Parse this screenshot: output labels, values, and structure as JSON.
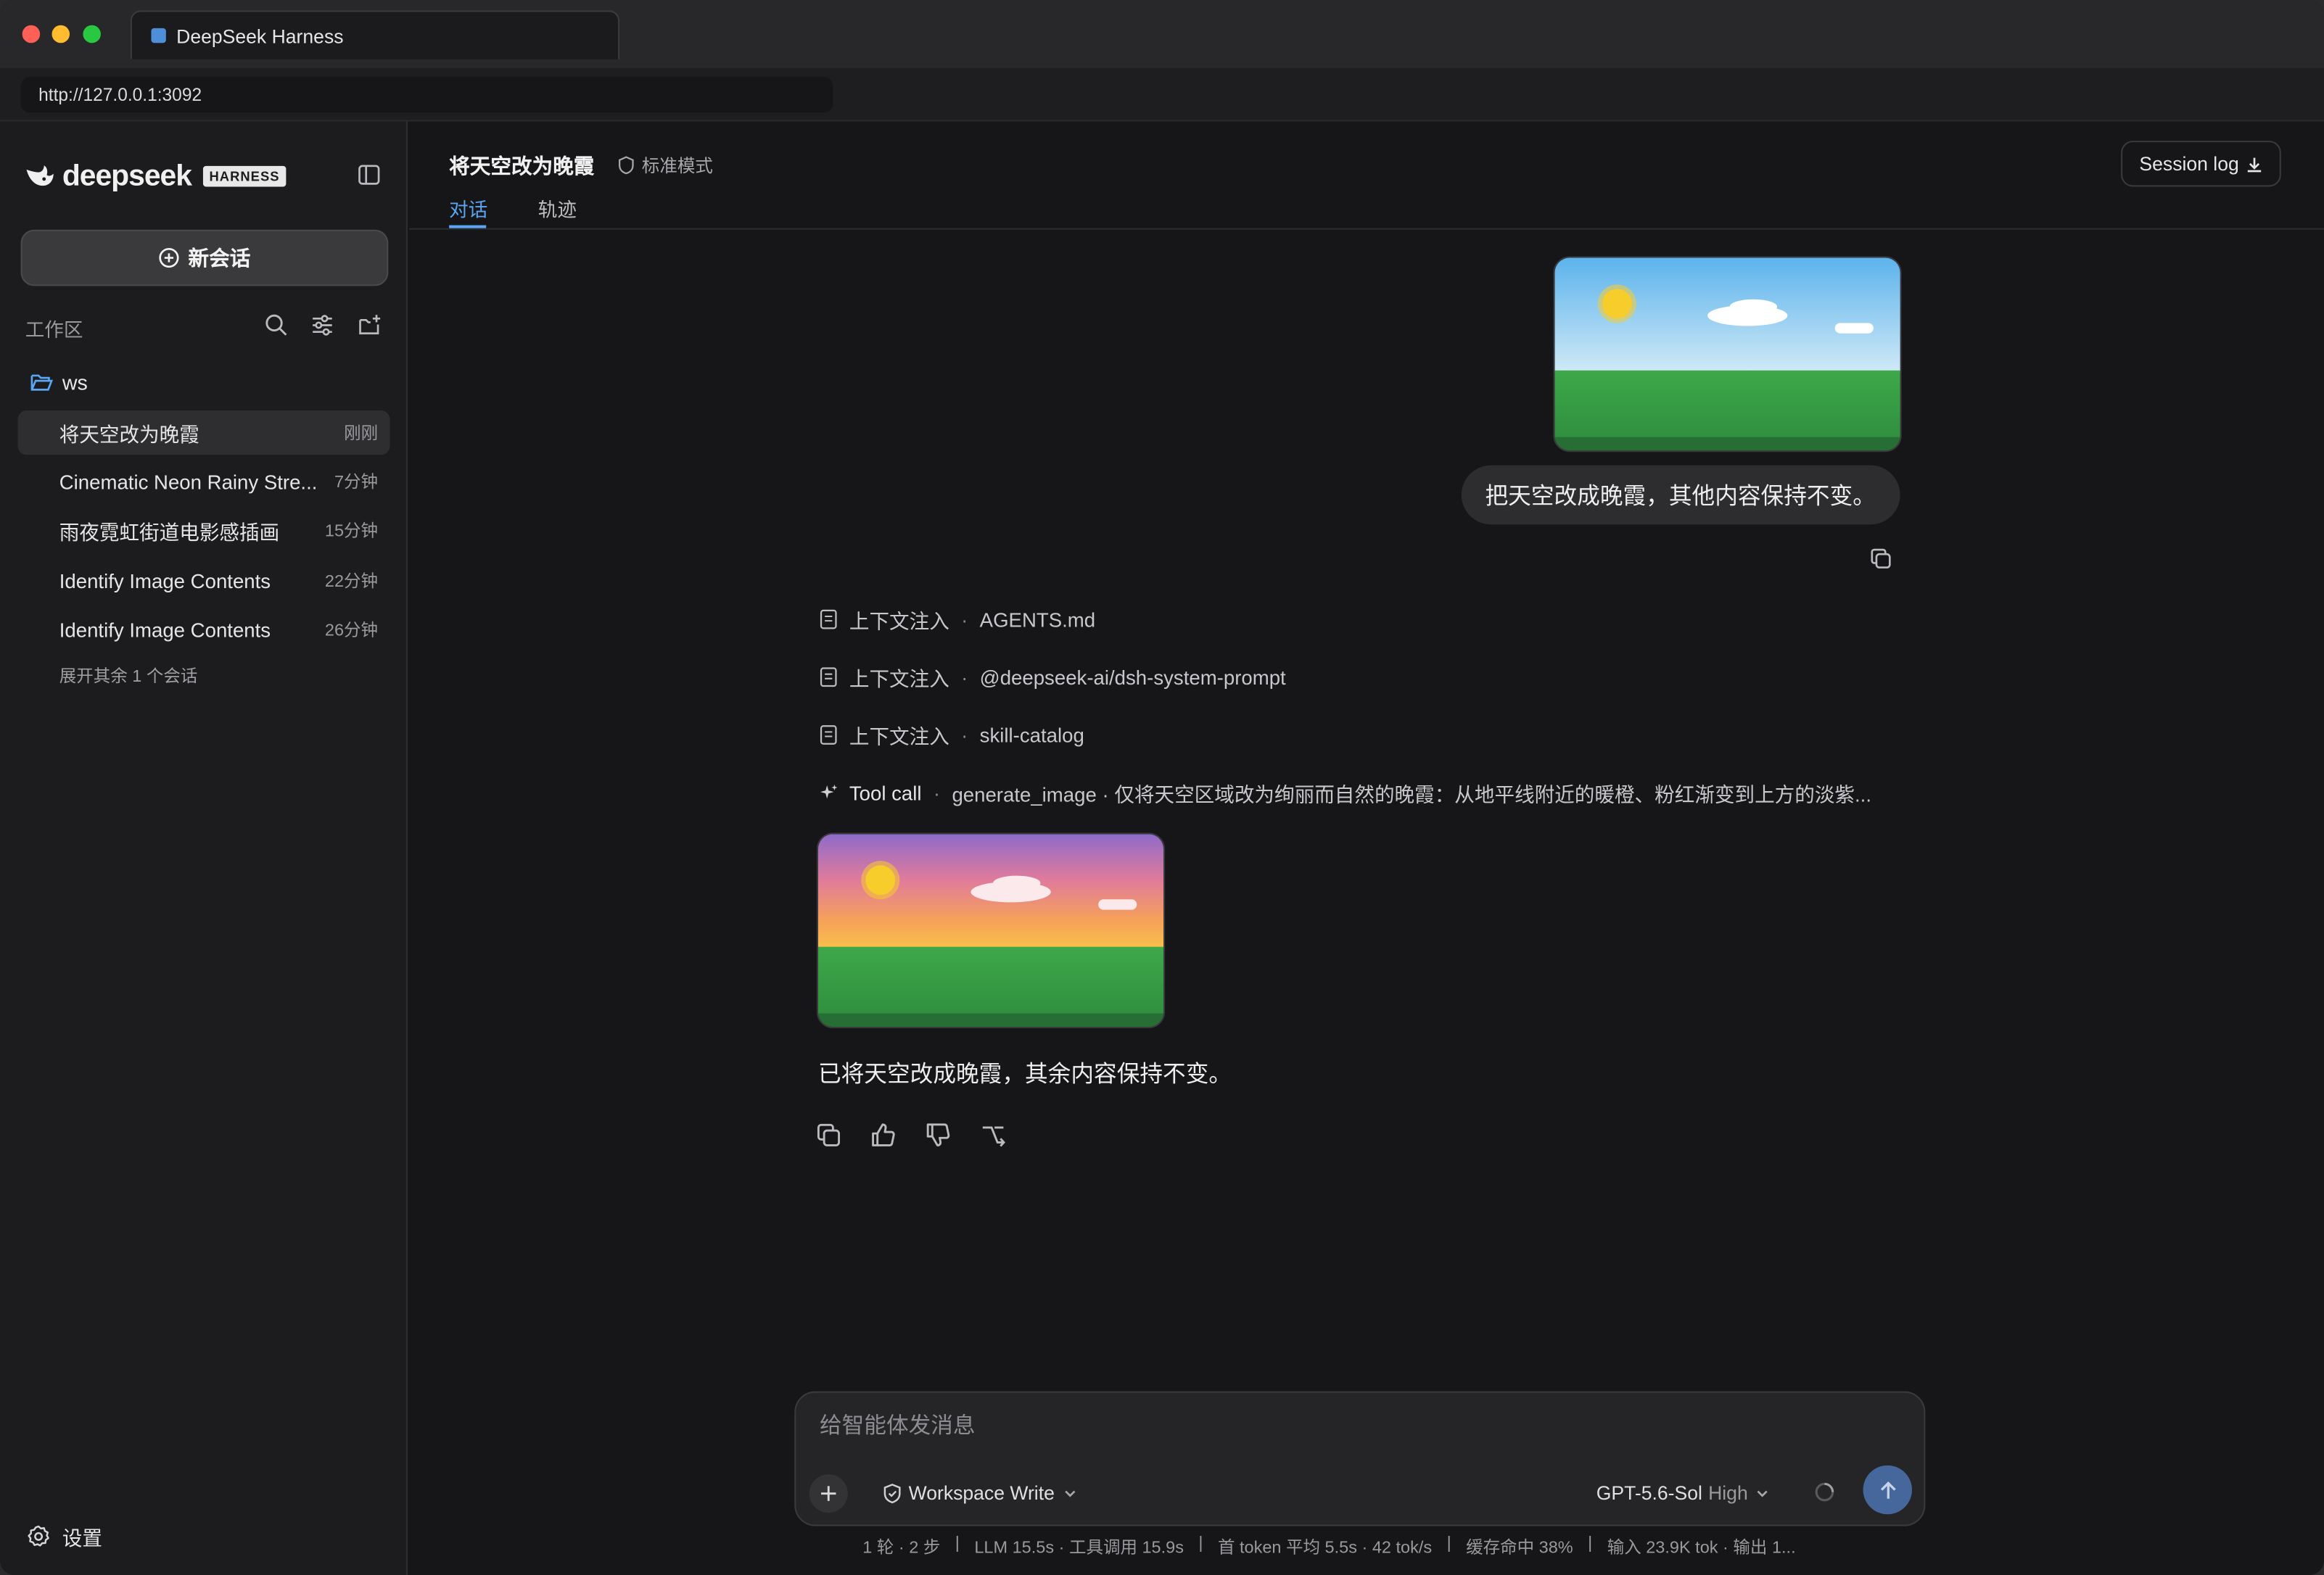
{
  "window": {
    "tab_title": "DeepSeek Harness",
    "url": "http://127.0.0.1:3092"
  },
  "sidebar": {
    "logo_word": "deepseek",
    "logo_badge": "HARNESS",
    "new_chat_label": "新会话",
    "workspace_title": "工作区",
    "folder_name": "ws",
    "sessions": [
      {
        "title": "将天空改为晚霞",
        "time": "刚刚"
      },
      {
        "title": "Cinematic Neon Rainy Stre...",
        "time": "7分钟"
      },
      {
        "title": "雨夜霓虹街道电影感插画",
        "time": "15分钟"
      },
      {
        "title": "Identify Image Contents",
        "time": "22分钟"
      },
      {
        "title": "Identify Image Contents",
        "time": "26分钟"
      }
    ],
    "more_label": "展开其余 1 个会话",
    "settings_label": "设置"
  },
  "header": {
    "title": "将天空改为晚霞",
    "mode": "标准模式",
    "tabs": [
      "对话",
      "轨迹"
    ],
    "session_log": "Session log"
  },
  "chat": {
    "user_message": "把天空改成晚霞，其他内容保持不变。",
    "context_items": [
      {
        "kind": "上下文注入",
        "value": "AGENTS.md"
      },
      {
        "kind": "上下文注入",
        "value": "@deepseek-ai/dsh-system-prompt"
      },
      {
        "kind": "上下文注入",
        "value": "skill-catalog"
      }
    ],
    "tool_call": {
      "kind": "Tool call",
      "value": "generate_image · 仅将天空区域改为绚丽而自然的晚霞：从地平线附近的暖橙、粉红渐变到上方的淡紫..."
    },
    "assistant_reply": "已将天空改成晚霞，其余内容保持不变。"
  },
  "composer": {
    "placeholder": "给智能体发消息",
    "workspace_mode": "Workspace Write",
    "model": "GPT-5.6-Sol",
    "effort": "High"
  },
  "stats": [
    "1 轮 · 2 步",
    "LLM 15.5s · 工具调用 15.9s",
    "首 token 平均 5.5s · 42 tok/s",
    "缓存命中 38%",
    "输入 23.9K tok · 输出 1..."
  ]
}
